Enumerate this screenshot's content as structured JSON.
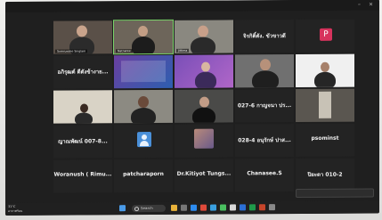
{
  "window": {
    "minimize_label": "–",
    "close_label": "×"
  },
  "tiles": [
    {
      "name": "Somruedee Singlam",
      "kind": "video"
    },
    {
      "name": "Natnaree",
      "kind": "video"
    },
    {
      "name": "Jittima",
      "kind": "video"
    },
    {
      "name": "",
      "big": "จิรกิติ์ตัง. ขัวขาวดี",
      "kind": "text"
    },
    {
      "name": "",
      "big": "",
      "kind": "avatar-p",
      "avatar_letter": "P"
    },
    {
      "name": "",
      "big": "อภิรุฒต์ ดีตังข้างาย...",
      "kind": "text"
    },
    {
      "name": "",
      "kind": "slide"
    },
    {
      "name": "",
      "kind": "video"
    },
    {
      "name": "",
      "kind": "video"
    },
    {
      "name": "",
      "kind": "video"
    },
    {
      "name": "",
      "big": "",
      "kind": "video"
    },
    {
      "name": "",
      "kind": "video"
    },
    {
      "name": "",
      "kind": "video"
    },
    {
      "name": "",
      "big": "027-6 กาญจนา ปร...",
      "kind": "text"
    },
    {
      "name": "",
      "kind": "video"
    },
    {
      "name": "",
      "big": "ญาณพัฒน์ 007-8...",
      "kind": "text"
    },
    {
      "name": "",
      "kind": "avatar-gen"
    },
    {
      "name": "",
      "kind": "video"
    },
    {
      "name": "",
      "big": "028-4 อนุรักษ์ ปาส...",
      "kind": "text"
    },
    {
      "name": "",
      "big": "psominst",
      "kind": "text"
    },
    {
      "name": "",
      "big": "Woranush ( Rimu...",
      "kind": "text"
    },
    {
      "name": "",
      "big": "patcharaporn",
      "kind": "text"
    },
    {
      "name": "",
      "big": "Dr.Kitiyot Tungs...",
      "kind": "text"
    },
    {
      "name": "",
      "big": "Chanasee.S",
      "kind": "text"
    },
    {
      "name": "",
      "big": "ปิยะดา 010-2",
      "kind": "text"
    }
  ],
  "taskbar": {
    "weather_line1": "31°C",
    "weather_line2": "อากาศร้อน",
    "search_label": "Search",
    "clock_line1": "",
    "clock_line2": ""
  },
  "toast": {
    "text": ""
  }
}
